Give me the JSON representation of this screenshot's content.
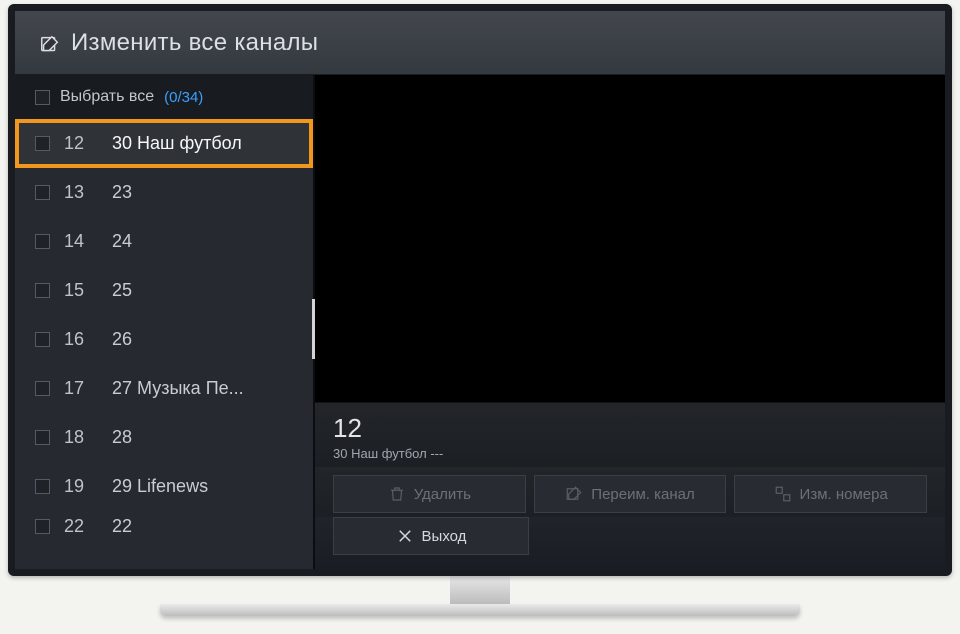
{
  "header": {
    "title": "Изменить все каналы"
  },
  "selectAll": {
    "label": "Выбрать все",
    "count": "(0/34)"
  },
  "channels": [
    {
      "num": "12",
      "name": "30 Наш футбол",
      "focused": true
    },
    {
      "num": "13",
      "name": "23"
    },
    {
      "num": "14",
      "name": "24"
    },
    {
      "num": "15",
      "name": "25"
    },
    {
      "num": "16",
      "name": "26"
    },
    {
      "num": "17",
      "name": "27 Музыка Пе..."
    },
    {
      "num": "18",
      "name": "28"
    },
    {
      "num": "19",
      "name": "29 Lifenews"
    },
    {
      "num": "22",
      "name": "22"
    }
  ],
  "preview": {
    "number": "12",
    "title": "30 Наш футбол ---"
  },
  "actions": {
    "delete": "Удалить",
    "rename": "Переим. канал",
    "renumber": "Изм. номера",
    "exit": "Выход"
  }
}
